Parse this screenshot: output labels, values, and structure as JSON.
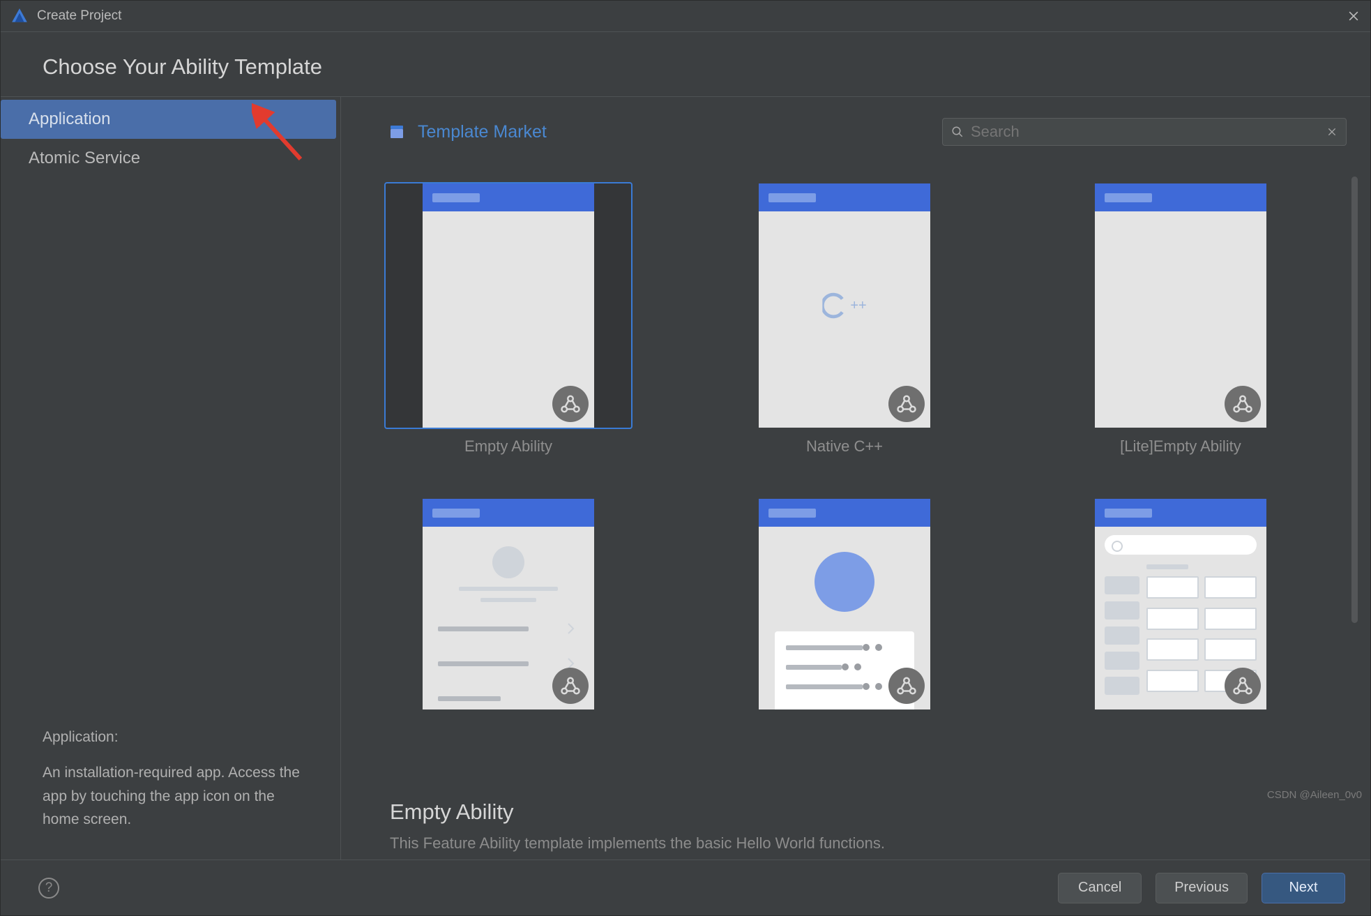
{
  "titlebar": {
    "title": "Create Project"
  },
  "heading": "Choose Your Ability Template",
  "sidebar": {
    "items": [
      {
        "label": "Application",
        "active": true
      },
      {
        "label": "Atomic Service",
        "active": false
      }
    ],
    "desc_title": "Application:",
    "desc_body": "An installation-required app. Access the app by touching the app icon on the home screen."
  },
  "header": {
    "market_label": "Template Market",
    "search_placeholder": "Search"
  },
  "templates": [
    {
      "label": "Empty Ability",
      "selected": true,
      "kind": "empty"
    },
    {
      "label": "Native C++",
      "selected": false,
      "kind": "cpp"
    },
    {
      "label": "[Lite]Empty Ability",
      "selected": false,
      "kind": "empty"
    },
    {
      "label": "",
      "selected": false,
      "kind": "list"
    },
    {
      "label": "",
      "selected": false,
      "kind": "journal"
    },
    {
      "label": "",
      "selected": false,
      "kind": "dash"
    }
  ],
  "details": {
    "name": "Empty Ability",
    "desc": "This Feature Ability template implements the basic Hello World functions."
  },
  "footer": {
    "cancel": "Cancel",
    "previous": "Previous",
    "next": "Next"
  },
  "watermark": "CSDN @Aileen_0v0"
}
